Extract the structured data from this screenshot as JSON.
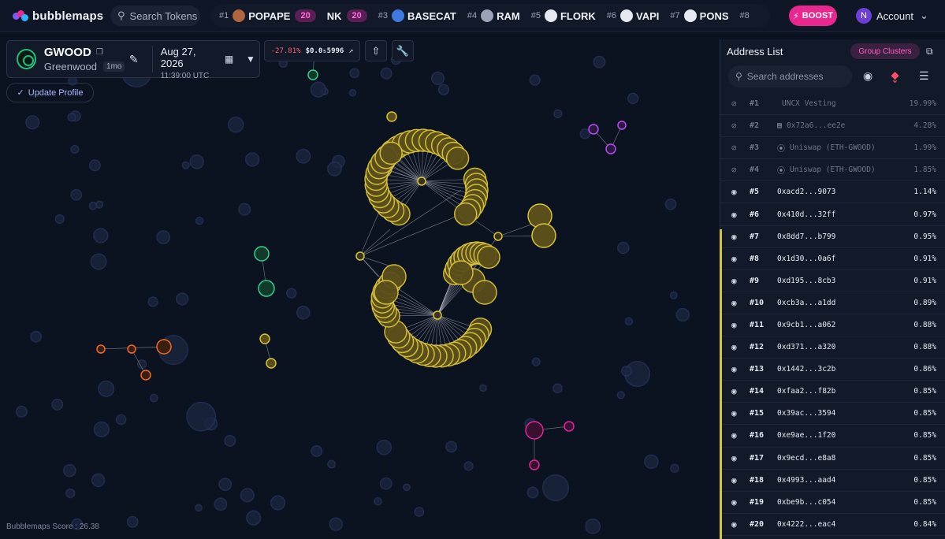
{
  "brand": {
    "name": "bubblemaps",
    "colors": [
      "#7f5af0",
      "#e8288f",
      "#2ab7ff"
    ]
  },
  "search_tokens": {
    "label": "Search Tokens",
    "icon": "search-icon"
  },
  "trending": [
    {
      "rank": "#1",
      "name": "POPAPE",
      "boost": "20",
      "avatar_color": "#b0653f"
    },
    {
      "rank": "",
      "name": "NK",
      "boost": "20",
      "avatar_color": ""
    },
    {
      "rank": "#3",
      "name": "BASECAT",
      "boost": "",
      "avatar_color": "#3d7ae0"
    },
    {
      "rank": "#4",
      "name": "RAM",
      "boost": "",
      "avatar_color": "#9aa3b8"
    },
    {
      "rank": "#5",
      "name": "FLORK",
      "boost": "",
      "avatar_color": "#e6e9f2"
    },
    {
      "rank": "#6",
      "name": "VAPI",
      "boost": "",
      "avatar_color": "#e6e9f2"
    },
    {
      "rank": "#7",
      "name": "PONS",
      "boost": "",
      "avatar_color": "#e6e9f2"
    },
    {
      "rank": "#8",
      "name": "",
      "boost": "",
      "avatar_color": ""
    }
  ],
  "boost_button": {
    "label": "BOOST"
  },
  "account": {
    "initial": "N",
    "label": "Account"
  },
  "token": {
    "symbol": "GWOOD",
    "name": "Greenwood",
    "age": "1mo",
    "date": "Aug 27, 2026",
    "time": "11:39:00 UTC"
  },
  "price": {
    "change": "-27.81%",
    "value": "$0.0₅5996"
  },
  "update_profile": {
    "label": "Update Profile"
  },
  "score": {
    "label": "Bubblemaps Score : 26.38"
  },
  "panel": {
    "title": "Address List",
    "group_clusters": "Group Clusters",
    "search_placeholder": "Search addresses",
    "accent": "#d9c33a",
    "rows": [
      {
        "rank": "#1",
        "label": "UNCX Vesting",
        "pct": "19.99%",
        "dim": true,
        "tag": "⮖"
      },
      {
        "rank": "#2",
        "label": "0x72a6...ee2e",
        "pct": "4.28%",
        "dim": true,
        "tag": "▤"
      },
      {
        "rank": "#3",
        "label": "Uniswap (ETH-GWOOD)",
        "pct": "1.99%",
        "dim": true,
        "tag": "⦿"
      },
      {
        "rank": "#4",
        "label": "Uniswap (ETH-GWOOD)",
        "pct": "1.85%",
        "dim": true,
        "tag": "⦿"
      },
      {
        "rank": "#5",
        "label": "0xacd2...9073",
        "pct": "1.14%",
        "dim": false,
        "tag": ""
      },
      {
        "rank": "#6",
        "label": "0x410d...32ff",
        "pct": "0.97%",
        "dim": false,
        "tag": ""
      },
      {
        "rank": "#7",
        "label": "0x8dd7...b799",
        "pct": "0.95%",
        "dim": false,
        "tag": ""
      },
      {
        "rank": "#8",
        "label": "0x1d30...0a6f",
        "pct": "0.91%",
        "dim": false,
        "tag": ""
      },
      {
        "rank": "#9",
        "label": "0xd195...8cb3",
        "pct": "0.91%",
        "dim": false,
        "tag": ""
      },
      {
        "rank": "#10",
        "label": "0xcb3a...a1dd",
        "pct": "0.89%",
        "dim": false,
        "tag": ""
      },
      {
        "rank": "#11",
        "label": "0x9cb1...a062",
        "pct": "0.88%",
        "dim": false,
        "tag": ""
      },
      {
        "rank": "#12",
        "label": "0xd371...a320",
        "pct": "0.88%",
        "dim": false,
        "tag": ""
      },
      {
        "rank": "#13",
        "label": "0x1442...3c2b",
        "pct": "0.86%",
        "dim": false,
        "tag": ""
      },
      {
        "rank": "#14",
        "label": "0xfaa2...f82b",
        "pct": "0.85%",
        "dim": false,
        "tag": ""
      },
      {
        "rank": "#15",
        "label": "0x39ac...3594",
        "pct": "0.85%",
        "dim": false,
        "tag": ""
      },
      {
        "rank": "#16",
        "label": "0xe9ae...1f20",
        "pct": "0.85%",
        "dim": false,
        "tag": ""
      },
      {
        "rank": "#17",
        "label": "0x9ecd...e8a8",
        "pct": "0.85%",
        "dim": false,
        "tag": ""
      },
      {
        "rank": "#18",
        "label": "0x4993...aad4",
        "pct": "0.85%",
        "dim": false,
        "tag": ""
      },
      {
        "rank": "#19",
        "label": "0xbe9b...c054",
        "pct": "0.85%",
        "dim": false,
        "tag": ""
      },
      {
        "rank": "#20",
        "label": "0x4222...eac4",
        "pct": "0.84%",
        "dim": false,
        "tag": ""
      }
    ]
  },
  "graph": {
    "colors": {
      "main": "#d9c33a",
      "green": "#2fd08a",
      "purple": "#b94cf0",
      "orange": "#f06a24",
      "magenta": "#e0259a",
      "ghost": "#2b3a5c"
    }
  }
}
